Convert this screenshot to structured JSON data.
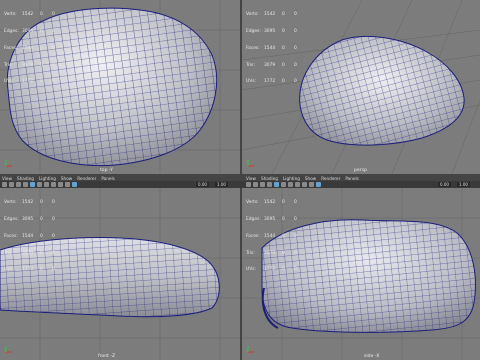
{
  "hud_labels": [
    "Verts:",
    "Edges:",
    "Faces:",
    "Tris:",
    "UVs:"
  ],
  "viewports": {
    "top_left": {
      "camera": "top -Y",
      "stats": [
        [
          "1542",
          "0",
          "0"
        ],
        [
          "3095",
          "0",
          "0"
        ],
        [
          "1544",
          "0",
          "0"
        ],
        [
          "3079",
          "0",
          "0"
        ],
        [
          "1772",
          "0",
          "0"
        ]
      ]
    },
    "top_right": {
      "camera": "persp",
      "stats": [
        [
          "1542",
          "0",
          "0"
        ],
        [
          "3095",
          "0",
          "0"
        ],
        [
          "1544",
          "0",
          "0"
        ],
        [
          "3079",
          "0",
          "0"
        ],
        [
          "1772",
          "0",
          "0"
        ]
      ]
    },
    "bottom_left": {
      "camera": "front -Z",
      "stats": [
        [
          "1542",
          "0",
          "0"
        ],
        [
          "3095",
          "0",
          "0"
        ],
        [
          "1544",
          "0",
          "0"
        ],
        [
          "3079",
          "0",
          "0"
        ],
        [
          "1772",
          "0",
          "0"
        ]
      ]
    },
    "bottom_right": {
      "camera": "side -X",
      "stats": [
        [
          "1542",
          "0",
          "0"
        ],
        [
          "3095",
          "0",
          "0"
        ],
        [
          "1544",
          "0",
          "0"
        ],
        [
          "3079",
          "0",
          "0"
        ],
        [
          "1772",
          "0",
          "0"
        ]
      ]
    }
  },
  "panel_menu": [
    "View",
    "Shading",
    "Lighting",
    "Show",
    "Renderer",
    "Panels"
  ],
  "toolbar": {
    "value_a": "0.00",
    "value_b": "1.00"
  },
  "colors": {
    "viewport_bg": "#7c7c7c",
    "grid": "#5f5f5f",
    "wire": "#1c1f7a",
    "mesh": "#c4c4cc"
  }
}
